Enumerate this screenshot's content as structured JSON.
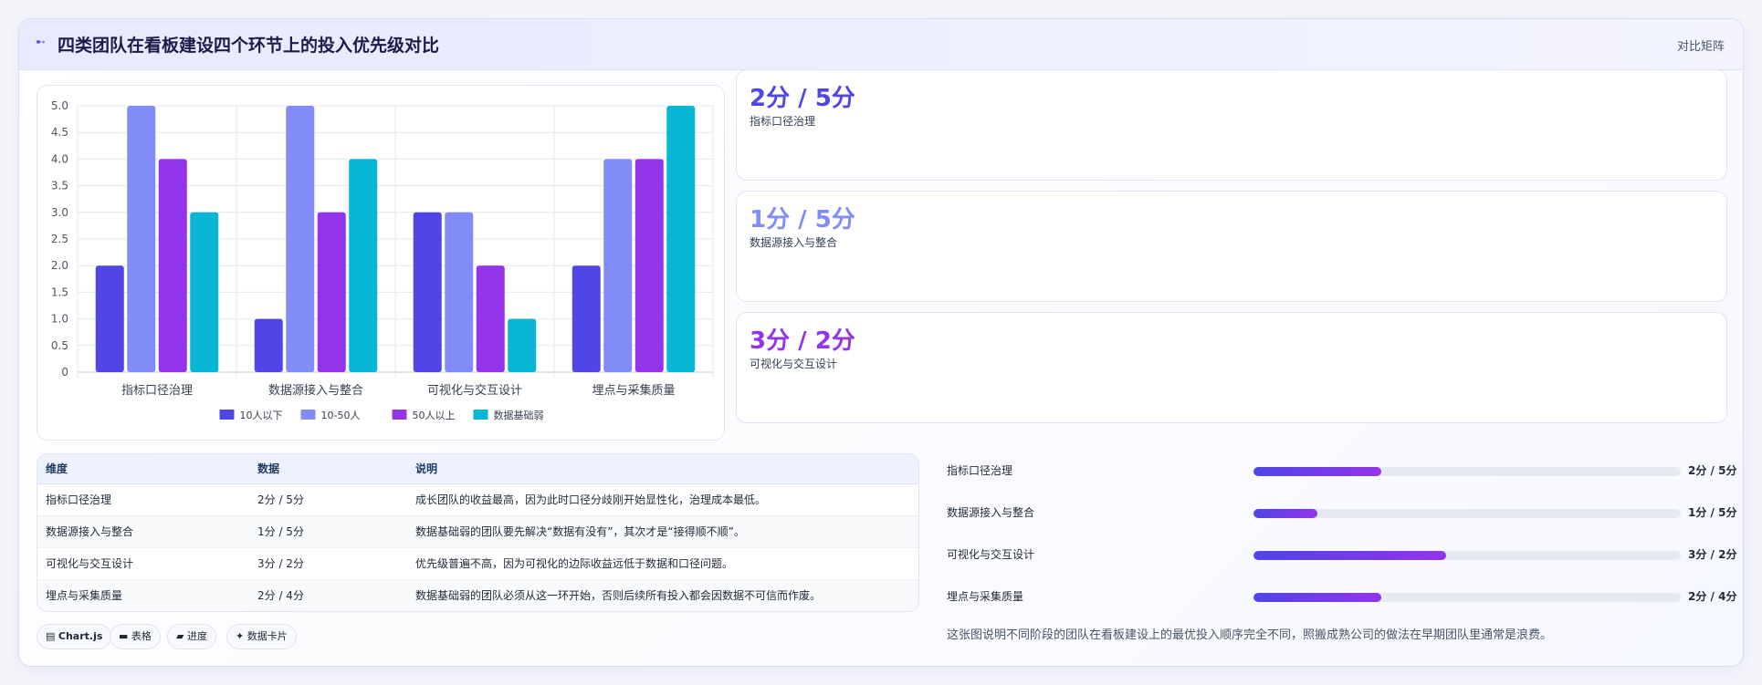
{
  "header": {
    "icon": "chart-icon",
    "title": "四类团队在看板建设四个环节上的投入优先级对比",
    "right_label": "对比矩阵"
  },
  "chart_data": {
    "type": "bar",
    "categories": [
      "指标口径治理",
      "数据源接入与整合",
      "可视化与交互设计",
      "埋点与采集质量"
    ],
    "series": [
      {
        "name": "10人以下",
        "values": [
          2,
          1,
          3,
          2
        ],
        "color": "#4f46e5"
      },
      {
        "name": "10-50人",
        "values": [
          5,
          5,
          3,
          4
        ],
        "color": "#818cf8"
      },
      {
        "name": "50人以上",
        "values": [
          4,
          3,
          2,
          4
        ],
        "color": "#9333ea"
      },
      {
        "name": "数据基础弱",
        "values": [
          3,
          4,
          1,
          5
        ],
        "color": "#06b6d4"
      }
    ],
    "ylim": [
      0,
      5
    ],
    "yticks": [
      "0",
      "0.5",
      "1.0",
      "1.5",
      "2.0",
      "2.5",
      "3.0",
      "3.5",
      "4.0",
      "4.5",
      "5.0"
    ],
    "grid": true,
    "legend_position": "bottom"
  },
  "stats": [
    {
      "value": "2分 / 5分",
      "label": "指标口径治理",
      "color": "#4f46e5"
    },
    {
      "value": "1分 / 5分",
      "label": "数据源接入与整合",
      "color": "#818cf8"
    },
    {
      "value": "3分 / 2分",
      "label": "可视化与交互设计",
      "color": "#9333ea"
    }
  ],
  "table": {
    "headers": [
      "维度",
      "数据",
      "说明"
    ],
    "rows": [
      [
        "指标口径治理",
        "2分 / 5分",
        "成长团队的收益最高，因为此时口径分歧刚开始显性化，治理成本最低。"
      ],
      [
        "数据源接入与整合",
        "1分 / 5分",
        "数据基础弱的团队要先解决“数据有没有”，其次才是“接得顺不顺”。"
      ],
      [
        "可视化与交互设计",
        "3分 / 2分",
        "优先级普遍不高，因为可视化的边际收益远低于数据和口径问题。"
      ],
      [
        "埋点与采集质量",
        "2分 / 4分",
        "数据基础弱的团队必须从这一环开始，否则后续所有投入都会因数据不可信而作废。"
      ]
    ]
  },
  "progress": [
    {
      "label": "指标口径治理",
      "value": "2分 / 5分",
      "fraction": 0.3
    },
    {
      "label": "数据源接入与整合",
      "value": "1分 / 5分",
      "fraction": 0.15
    },
    {
      "label": "可视化与交互设计",
      "value": "3分 / 2分",
      "fraction": 0.45
    },
    {
      "label": "埋点与采集质量",
      "value": "2分 / 4分",
      "fraction": 0.3
    }
  ],
  "note": "这张图说明不同阶段的团队在看板建设上的最优投入顺序完全不同，照搬成熟公司的做法在早期团队里通常是浪费。",
  "tags": [
    {
      "icon": "chart-icon",
      "label": "Chart.js",
      "bold": true
    },
    {
      "icon": "table-icon",
      "label": "表格",
      "bold": false
    },
    {
      "icon": "progress-icon",
      "label": "进度",
      "bold": false
    },
    {
      "icon": "sparkle-icon",
      "label": "数据卡片",
      "bold": false
    }
  ]
}
